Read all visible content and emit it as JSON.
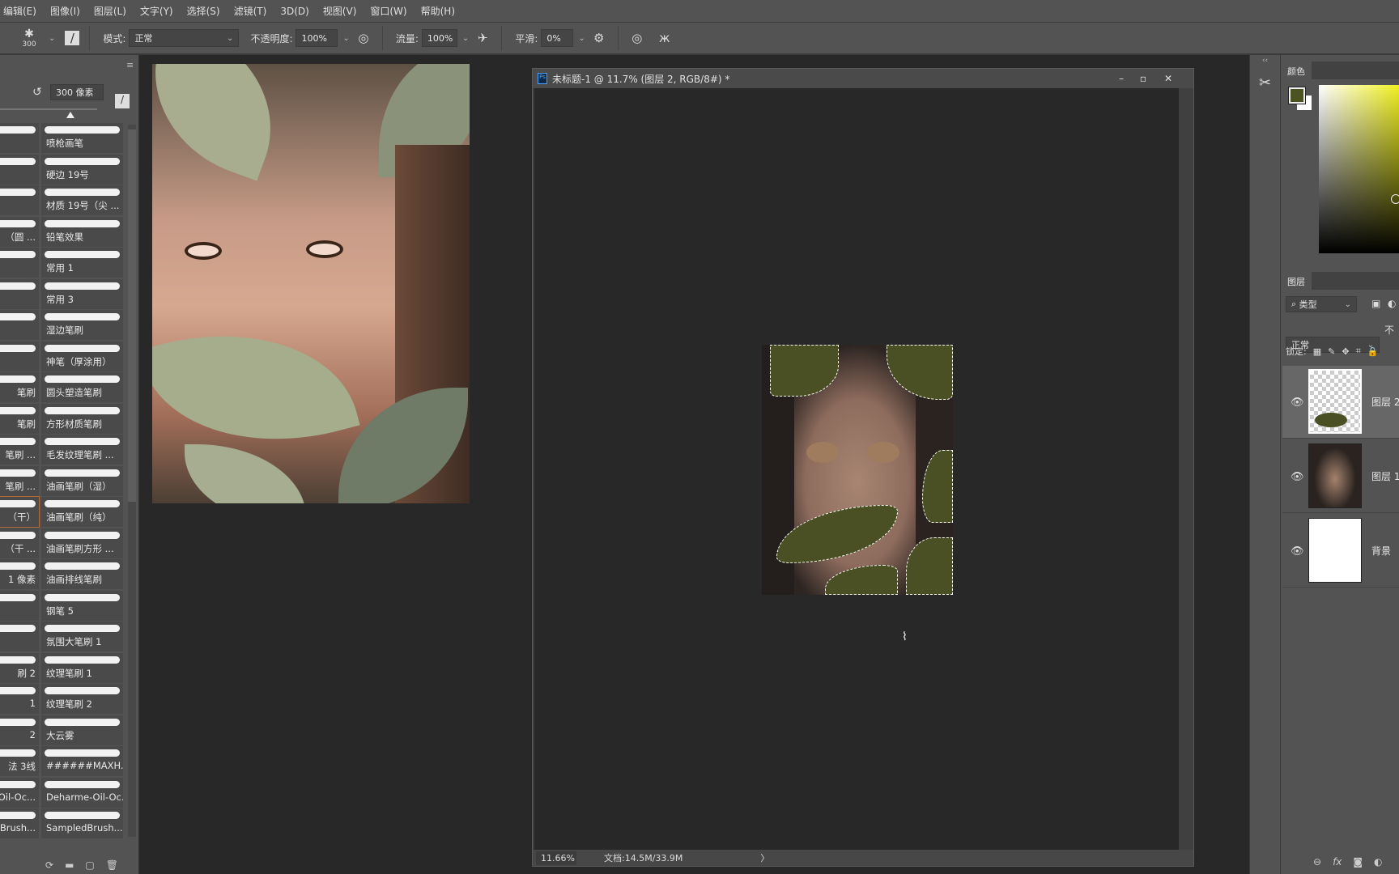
{
  "menu": [
    "编辑(E)",
    "图像(I)",
    "图层(L)",
    "文字(Y)",
    "选择(S)",
    "滤镜(T)",
    "3D(D)",
    "视图(V)",
    "窗口(W)",
    "帮助(H)"
  ],
  "options": {
    "brush_size": "300",
    "mode_label": "模式:",
    "mode_value": "正常",
    "opacity_label": "不透明度:",
    "opacity_value": "100%",
    "flow_label": "流量:",
    "flow_value": "100%",
    "smooth_label": "平滑:",
    "smooth_value": "0%"
  },
  "brush_panel": {
    "size_value": "300 像素",
    "left_labels": [
      "",
      "",
      "",
      "（圆 ...",
      "",
      "",
      "",
      "",
      "笔刷",
      "笔刷",
      "笔刷 ...",
      "笔刷 ...",
      "（干）",
      "（干 ...",
      "1 像素",
      "",
      "",
      "刷 2",
      "1",
      "2",
      "法 3线",
      "-Oil-Oc...",
      "Brush..."
    ],
    "right_labels": [
      "喷枪画笔",
      "硬边 19号",
      "材质 19号（尖 ...",
      "铅笔效果",
      "常用 1",
      "常用 3",
      "湿边笔刷",
      "神笔（厚涂用）",
      "圆头塑造笔刷",
      "方形材质笔刷",
      "毛发纹理笔刷 ...",
      "油画笔刷（湿）",
      "油画笔刷（纯）",
      "油画笔刷方形 ...",
      "油画排线笔刷",
      "钢笔 5",
      "氛围大笔刷 1",
      "纹理笔刷 1",
      "纹理笔刷 2",
      "大云雾",
      "######MAXH...",
      "Deharme-Oil-Oc...",
      "SampledBrush..."
    ]
  },
  "document": {
    "title": "未标题-1 @ 11.7% (图层 2, RGB/8#) *",
    "zoom": "11.66%",
    "doc_info": "文档:14.5M/33.9M"
  },
  "color_panel": {
    "tab": "颜色",
    "foreground": "#4d5320",
    "background": "#ffffff"
  },
  "layers_panel": {
    "tab": "图层",
    "filter": "类型",
    "blend": "正常",
    "opacity_label": "不",
    "lock_label": "锁定:",
    "layers": [
      {
        "name": "图层 2",
        "visible": true,
        "selected": true
      },
      {
        "name": "图层 1",
        "visible": true
      },
      {
        "name": "背景",
        "visible": true
      }
    ]
  }
}
